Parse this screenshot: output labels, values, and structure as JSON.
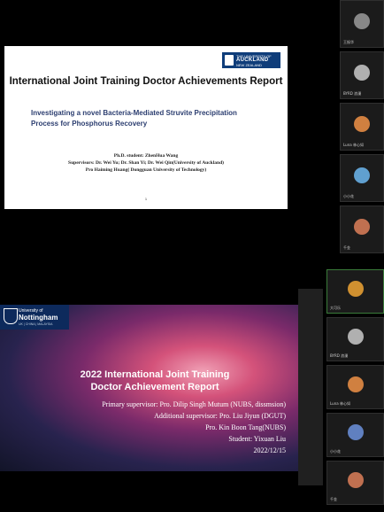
{
  "slide1": {
    "logo": {
      "line1": "THE UNIVERSITY OF",
      "line2": "AUCKLAND",
      "line3": "NEW ZEALAND"
    },
    "title": "International Joint Training Doctor Achievements Report",
    "subtitle_line1": "Investigating a novel Bacteria-Mediated Struvite Precipitation",
    "subtitle_line2": "Process for Phosphorus Recovery",
    "student": "Ph.D. student: ZhenHua Wang",
    "supervisors1": "Supervisors: Dr. Wei Yu; Dr. Shan Yi; Dr. Wei Qin(University of Auckland)",
    "supervisors2": "Pro Haiming Huang( Dongguan University of Technology)",
    "page": "1"
  },
  "slide2": {
    "logo": {
      "line1": "University of",
      "line2": "Nottingham",
      "line3": "UK | CHINA | MALAYSIA"
    },
    "title_line1": "2022 International Joint Training",
    "title_line2": "Doctor Achievement Report",
    "primary": "Primary supervisor: Pro. Dilip Singh Mutum (NUBS, dissmsion)",
    "additional": "Additional supervisor: Pro. Liu Jiyun (DGUT)",
    "pro": "Pro. Kin Boon Tang(NUBS)",
    "student": "Student: Yixuan Liu",
    "date": "2022/12/15"
  },
  "participants_top": [
    {
      "name": "王振华",
      "color": "#888888"
    },
    {
      "name": "BYRD 浪漫",
      "color": "#b0b0b0"
    },
    {
      "name": "Luna 林心如",
      "color": "#d08040"
    },
    {
      "name": "小小花",
      "color": "#60a0d0"
    },
    {
      "name": "千金",
      "color": "#c07050"
    }
  ],
  "participants_bottom": [
    {
      "name": "大可乐",
      "color": "#d09030"
    },
    {
      "name": "BYRD 浪漫",
      "color": "#b0b0b0"
    },
    {
      "name": "Luna 林心如",
      "color": "#d08040"
    },
    {
      "name": "小小花",
      "color": "#6080c0"
    },
    {
      "name": "千金",
      "color": "#c07050"
    }
  ]
}
